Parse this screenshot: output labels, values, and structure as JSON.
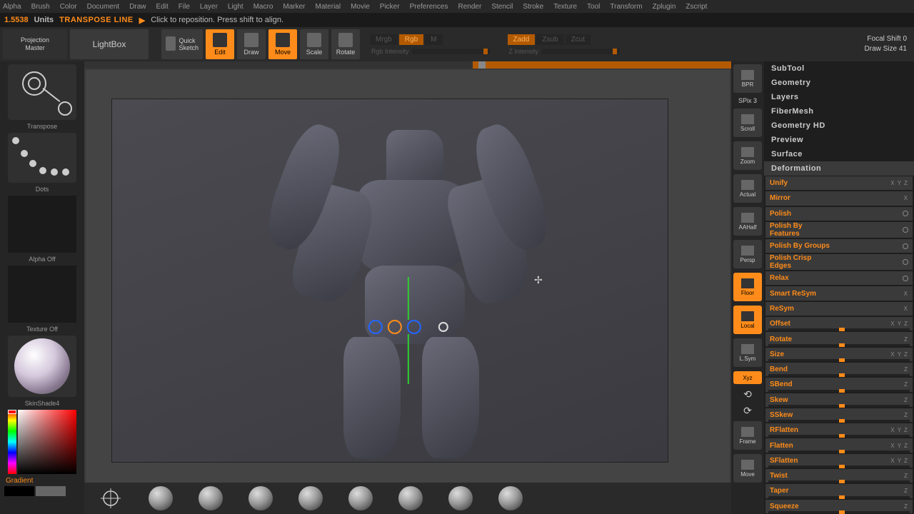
{
  "menu": [
    "Alpha",
    "Brush",
    "Color",
    "Document",
    "Draw",
    "Edit",
    "File",
    "Layer",
    "Light",
    "Macro",
    "Marker",
    "Material",
    "Movie",
    "Picker",
    "Preferences",
    "Render",
    "Stencil",
    "Stroke",
    "Texture",
    "Tool",
    "Transform",
    "Zplugin",
    "Zscript"
  ],
  "status": {
    "value": "1.5538",
    "units": "Units",
    "mode": "TRANSPOSE LINE",
    "hint": "Click to reposition. Press shift to align."
  },
  "toolbar": {
    "projection_master": "Projection\nMaster",
    "lightbox": "LightBox",
    "quick_sketch": "Quick\nSketch",
    "edit": "Edit",
    "draw": "Draw",
    "move": "Move",
    "scale": "Scale",
    "rotate": "Rotate"
  },
  "rgbz": {
    "mrgb": "Mrgb",
    "rgb": "Rgb",
    "m": "M",
    "rgb_intensity": "Rgb Intensity",
    "zadd": "Zadd",
    "zsub": "Zsub",
    "zcut": "Zcut",
    "z_intensity": "Z Intensity"
  },
  "rightinfo": {
    "focal_shift_label": "Focal Shift",
    "focal_shift_value": "0",
    "draw_size_label": "Draw Size",
    "draw_size_value": "41"
  },
  "left": {
    "transpose": "Transpose",
    "dots": "Dots",
    "alpha_off": "Alpha Off",
    "texture_off": "Texture Off",
    "material": "SkinShade4",
    "gradient": "Gradient"
  },
  "rtool": {
    "bpr": "BPR",
    "spix": "SPix 3",
    "scroll": "Scroll",
    "zoom": "Zoom",
    "actual": "Actual",
    "aahalf": "AAHalf",
    "persp": "Persp",
    "floor": "Floor",
    "local": "Local",
    "lsym": "L.Sym",
    "xyz": "Xyz",
    "frame": "Frame",
    "move": "Move"
  },
  "right_sections": [
    "SubTool",
    "Geometry",
    "Layers",
    "FiberMesh",
    "Geometry HD",
    "Preview",
    "Surface"
  ],
  "deformation": {
    "title": "Deformation",
    "unify": "Unify",
    "mirror": "Mirror",
    "items": [
      {
        "name": "Polish",
        "type": "dot"
      },
      {
        "name": "Polish By Features",
        "type": "dot"
      },
      {
        "name": "Polish By Groups",
        "type": "dot"
      },
      {
        "name": "Polish Crisp Edges",
        "type": "dot"
      },
      {
        "name": "Relax",
        "type": "dot"
      },
      {
        "name": "Smart ReSym",
        "type": "axis",
        "axis": "X"
      },
      {
        "name": "ReSym",
        "type": "axis",
        "axis": "X"
      },
      {
        "name": "Offset",
        "type": "slider",
        "axis": "X Y Z"
      },
      {
        "name": "Rotate",
        "type": "slider",
        "axis": "Z"
      },
      {
        "name": "Size",
        "type": "slider",
        "axis": "X Y Z"
      },
      {
        "name": "Bend",
        "type": "slider",
        "axis": "Z"
      },
      {
        "name": "SBend",
        "type": "slider",
        "axis": "Z"
      },
      {
        "name": "Skew",
        "type": "slider",
        "axis": "Z"
      },
      {
        "name": "SSkew",
        "type": "slider",
        "axis": "Z"
      },
      {
        "name": "RFlatten",
        "type": "slider",
        "axis": "X Y Z"
      },
      {
        "name": "Flatten",
        "type": "slider",
        "axis": "X Y Z"
      },
      {
        "name": "SFlatten",
        "type": "slider",
        "axis": "X Y Z"
      },
      {
        "name": "Twist",
        "type": "slider",
        "axis": "Z"
      },
      {
        "name": "Taper",
        "type": "slider",
        "axis": "Z"
      },
      {
        "name": "Squeeze",
        "type": "slider",
        "axis": "Z"
      }
    ]
  }
}
